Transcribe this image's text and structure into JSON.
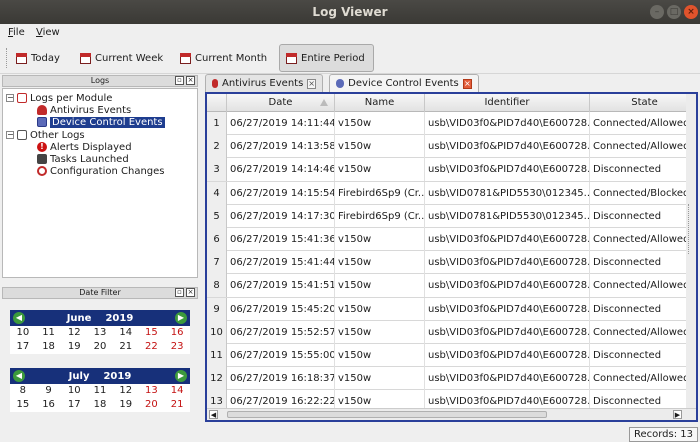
{
  "window": {
    "title": "Log Viewer"
  },
  "menu": [
    "File",
    "View"
  ],
  "toolbar": {
    "today": "Today",
    "current_week": "Current Week",
    "current_month": "Current Month",
    "entire_period": "Entire Period"
  },
  "logs_panel": {
    "title": "Logs",
    "tree": {
      "logs_per_module": "Logs per Module",
      "antivirus_events": "Antivirus Events",
      "device_control_events": "Device Control Events",
      "other_logs": "Other Logs",
      "alerts_displayed": "Alerts Displayed",
      "tasks_launched": "Tasks Launched",
      "configuration_changes": "Configuration Changes"
    }
  },
  "date_filter": {
    "title": "Date Filter",
    "june": {
      "month": "June",
      "year": "2019",
      "rows": [
        [
          "10",
          "11",
          "12",
          "13",
          "14",
          "15",
          "16"
        ],
        [
          "17",
          "18",
          "19",
          "20",
          "21",
          "22",
          "23"
        ]
      ]
    },
    "july": {
      "month": "July",
      "year": "2019",
      "rows": [
        [
          "8",
          "9",
          "10",
          "11",
          "12",
          "13",
          "14"
        ],
        [
          "15",
          "16",
          "17",
          "18",
          "19",
          "20",
          "21"
        ]
      ]
    }
  },
  "tabs": {
    "antivirus": "Antivirus Events",
    "device_control": "Device Control Events"
  },
  "table": {
    "columns": [
      "Date",
      "Name",
      "Identifier",
      "State"
    ],
    "rows": [
      [
        "1",
        "06/27/2019 14:11:44",
        "v150w",
        "usb\\VID03f0&PID7d40\\E600728...",
        "Connected/Allowed"
      ],
      [
        "2",
        "06/27/2019 14:13:58",
        "v150w",
        "usb\\VID03f0&PID7d40\\E600728...",
        "Connected/Allowed"
      ],
      [
        "3",
        "06/27/2019 14:14:46",
        "v150w",
        "usb\\VID03f0&PID7d40\\E600728...",
        "Disconnected"
      ],
      [
        "4",
        "06/27/2019 14:15:54",
        "Firebird6Sp9 (Cr...",
        "usb\\VID0781&PID5530\\012345...",
        "Connected/Blocked"
      ],
      [
        "5",
        "06/27/2019 14:17:30",
        "Firebird6Sp9 (Cr...",
        "usb\\VID0781&PID5530\\012345...",
        "Disconnected"
      ],
      [
        "6",
        "06/27/2019 15:41:36",
        "v150w",
        "usb\\VID03f0&PID7d40\\E600728...",
        "Connected/Allowed"
      ],
      [
        "7",
        "06/27/2019 15:41:44",
        "v150w",
        "usb\\VID03f0&PID7d40\\E600728...",
        "Disconnected"
      ],
      [
        "8",
        "06/27/2019 15:41:51",
        "v150w",
        "usb\\VID03f0&PID7d40\\E600728...",
        "Connected/Allowed"
      ],
      [
        "9",
        "06/27/2019 15:45:20",
        "v150w",
        "usb\\VID03f0&PID7d40\\E600728...",
        "Disconnected"
      ],
      [
        "10",
        "06/27/2019 15:52:57",
        "v150w",
        "usb\\VID03f0&PID7d40\\E600728...",
        "Connected/Allowed"
      ],
      [
        "11",
        "06/27/2019 15:55:00",
        "v150w",
        "usb\\VID03f0&PID7d40\\E600728...",
        "Disconnected"
      ],
      [
        "12",
        "06/27/2019 16:18:37",
        "v150w",
        "usb\\VID03f0&PID7d40\\E600728...",
        "Connected/Allowed"
      ],
      [
        "13",
        "06/27/2019 16:22:22",
        "v150w",
        "usb\\VID03f0&PID7d40\\E600728...",
        "Disconnected"
      ]
    ]
  },
  "status": {
    "records": "Records: 13"
  },
  "colors": {
    "accent": "#1e3d8f",
    "titlebar": "#3c3b37",
    "close": "#e0532c"
  }
}
